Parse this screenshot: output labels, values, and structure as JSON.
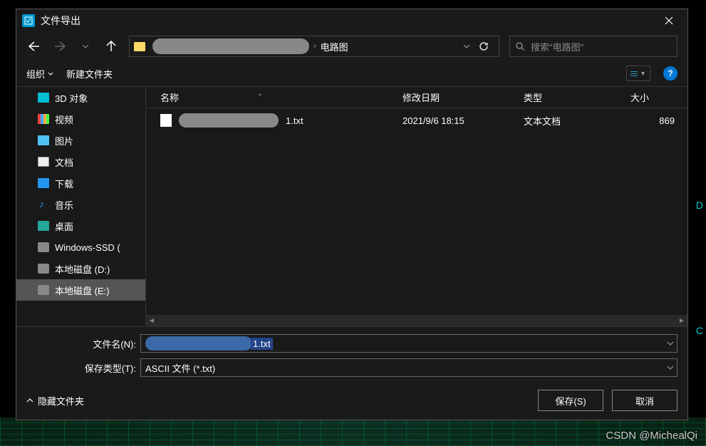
{
  "title": "文件导出",
  "path": {
    "segment": "电路图"
  },
  "search": {
    "placeholder": "搜索\"电路图\""
  },
  "toolbar": {
    "organize": "组织",
    "newfolder": "新建文件夹"
  },
  "columns": {
    "name": "名称",
    "date": "修改日期",
    "type": "类型",
    "size": "大小"
  },
  "sidebar": {
    "items": [
      {
        "label": "3D 对象",
        "icon": "ico-3d"
      },
      {
        "label": "视频",
        "icon": "ico-video"
      },
      {
        "label": "图片",
        "icon": "ico-pic"
      },
      {
        "label": "文档",
        "icon": "ico-doc"
      },
      {
        "label": "下载",
        "icon": "ico-dl"
      },
      {
        "label": "音乐",
        "icon": "ico-music"
      },
      {
        "label": "桌面",
        "icon": "ico-desk"
      },
      {
        "label": "Windows-SSD (",
        "icon": "ico-disk"
      },
      {
        "label": "本地磁盘 (D:)",
        "icon": "ico-disk"
      },
      {
        "label": "本地磁盘 (E:)",
        "icon": "ico-disk",
        "selected": true
      }
    ]
  },
  "files": [
    {
      "name_suffix": "1.txt",
      "date": "2021/9/6 18:15",
      "type": "文本文档",
      "size": "869"
    }
  ],
  "filename": {
    "label": "文件名(N):",
    "suffix": "1.txt"
  },
  "filetype": {
    "label": "保存类型(T):",
    "value": "ASCII 文件 (*.txt)"
  },
  "actions": {
    "hide": "隐藏文件夹",
    "save": "保存(S)",
    "cancel": "取消"
  },
  "watermark": "CSDN @MichealQi",
  "bg": {
    "d": "D",
    "c": "C"
  }
}
